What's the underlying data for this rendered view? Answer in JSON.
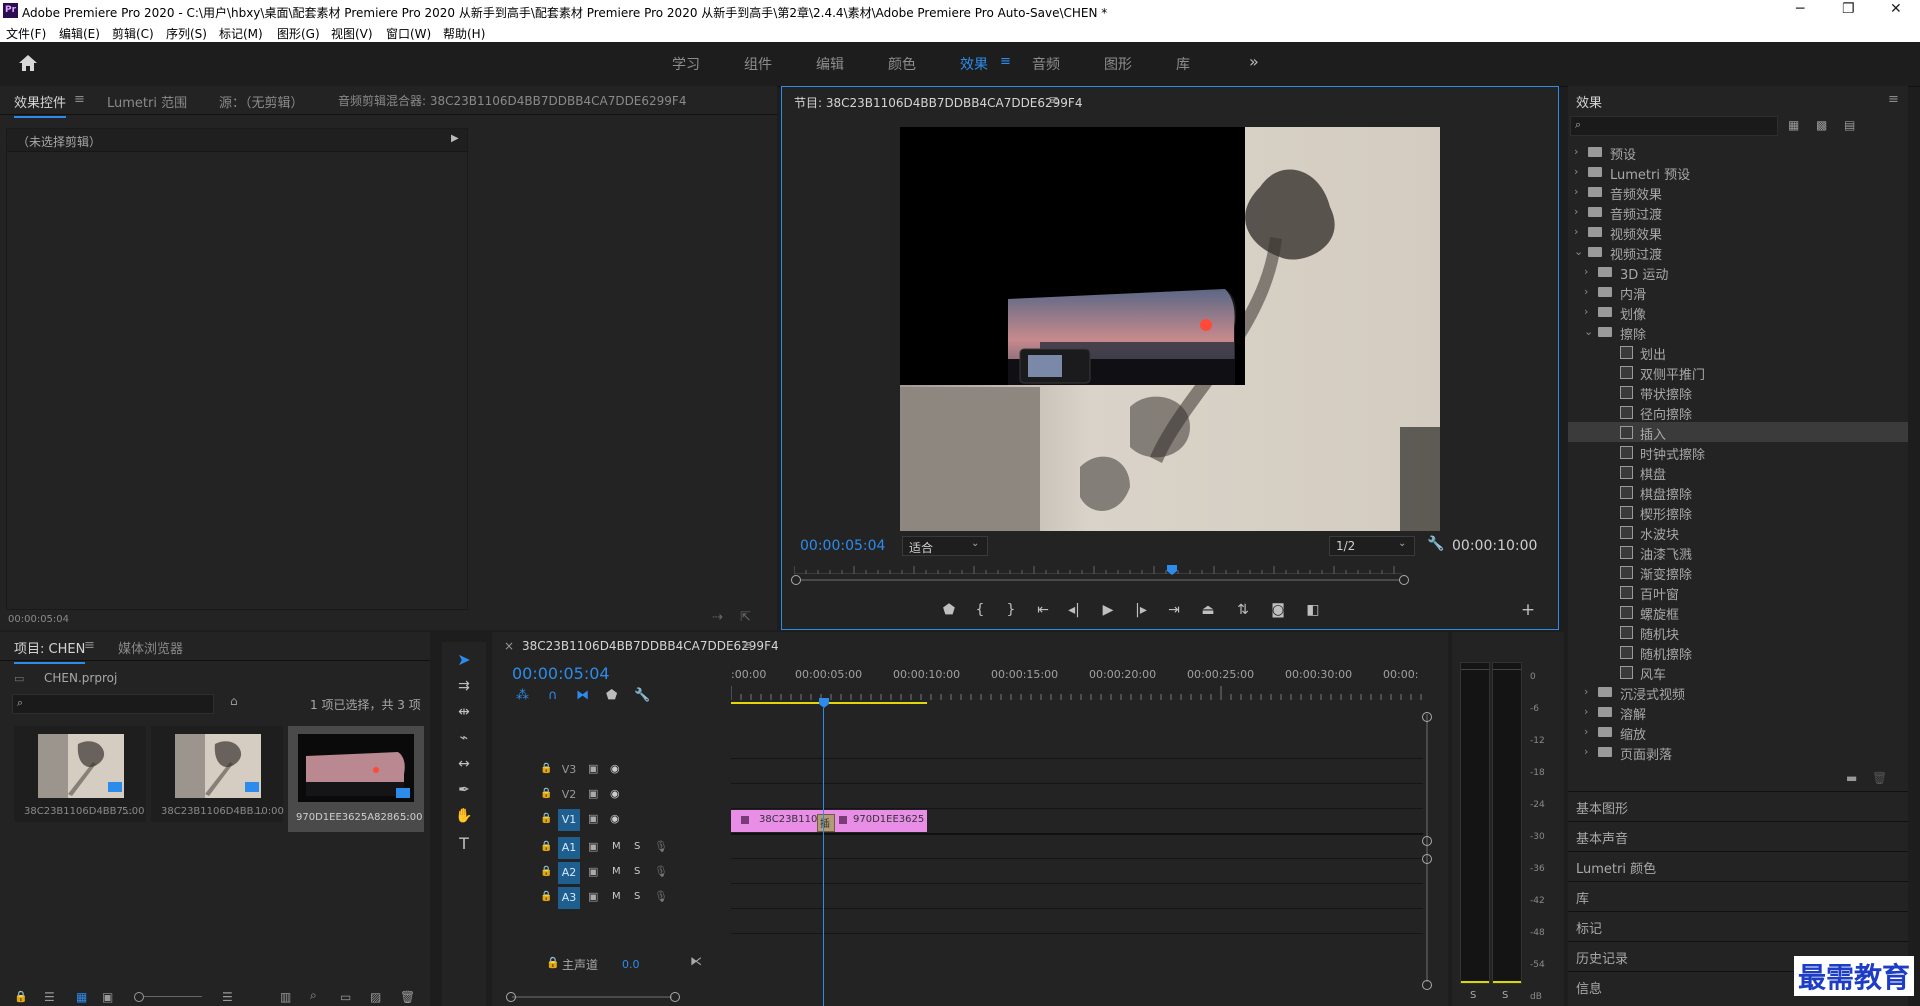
{
  "window": {
    "app_icon": "Pr",
    "title": "Adobe Premiere Pro 2020 - C:\\用户\\hbxy\\桌面\\配套素材 Premiere Pro 2020 从新手到高手\\配套素材 Premiere Pro 2020 从新手到高手\\第2章\\2.4.4\\素材\\Adobe Premiere Pro Auto-Save\\CHEN *",
    "minimize": "─",
    "maximize": "❐",
    "close": "✕"
  },
  "menu": [
    "文件(F)",
    "编辑(E)",
    "剪辑(C)",
    "序列(S)",
    "标记(M)",
    "图形(G)",
    "视图(V)",
    "窗口(W)",
    "帮助(H)"
  ],
  "workspaces": {
    "tabs": [
      "学习",
      "组件",
      "编辑",
      "颜色",
      "效果",
      "音频",
      "图形",
      "库"
    ],
    "active": "效果",
    "more": "»"
  },
  "effect_controls": {
    "tabs": [
      "效果控件",
      "Lumetri 范围",
      "源：（无剪辑）",
      "音频剪辑混合器: 38C23B1106D4BB7DDBB4CA7DDE6299F4"
    ],
    "no_clip": "（未选择剪辑）",
    "timecode": "00:00:05:04"
  },
  "program": {
    "title": "节目: 38C23B1106D4BB7DDBB4CA7DDE6299F4",
    "current_time": "00:00:05:04",
    "fit": "适合",
    "resolution": "1/2",
    "duration": "00:00:10:00",
    "playhead_fraction": 0.5
  },
  "effects": {
    "title": "效果",
    "search_placeholder": "",
    "tree": [
      {
        "label": "预设",
        "kind": "folder",
        "level": 0,
        "open": false
      },
      {
        "label": "Lumetri 预设",
        "kind": "folder",
        "level": 0,
        "open": false
      },
      {
        "label": "音频效果",
        "kind": "folder",
        "level": 0,
        "open": false
      },
      {
        "label": "音频过渡",
        "kind": "folder",
        "level": 0,
        "open": false
      },
      {
        "label": "视频效果",
        "kind": "folder",
        "level": 0,
        "open": false
      },
      {
        "label": "视频过渡",
        "kind": "folder",
        "level": 0,
        "open": true
      },
      {
        "label": "3D 运动",
        "kind": "folder",
        "level": 1,
        "open": false
      },
      {
        "label": "内滑",
        "kind": "folder",
        "level": 1,
        "open": false
      },
      {
        "label": "划像",
        "kind": "folder",
        "level": 1,
        "open": false
      },
      {
        "label": "擦除",
        "kind": "folder",
        "level": 1,
        "open": true
      },
      {
        "label": "划出",
        "kind": "fx",
        "level": 2
      },
      {
        "label": "双侧平推门",
        "kind": "fx",
        "level": 2
      },
      {
        "label": "带状擦除",
        "kind": "fx",
        "level": 2
      },
      {
        "label": "径向擦除",
        "kind": "fx",
        "level": 2
      },
      {
        "label": "插入",
        "kind": "fx",
        "level": 2,
        "selected": true
      },
      {
        "label": "时钟式擦除",
        "kind": "fx",
        "level": 2
      },
      {
        "label": "棋盘",
        "kind": "fx",
        "level": 2
      },
      {
        "label": "棋盘擦除",
        "kind": "fx",
        "level": 2
      },
      {
        "label": "楔形擦除",
        "kind": "fx",
        "level": 2
      },
      {
        "label": "水波块",
        "kind": "fx",
        "level": 2
      },
      {
        "label": "油漆飞溅",
        "kind": "fx",
        "level": 2
      },
      {
        "label": "渐变擦除",
        "kind": "fx",
        "level": 2
      },
      {
        "label": "百叶窗",
        "kind": "fx",
        "level": 2
      },
      {
        "label": "螺旋框",
        "kind": "fx",
        "level": 2
      },
      {
        "label": "随机块",
        "kind": "fx",
        "level": 2
      },
      {
        "label": "随机擦除",
        "kind": "fx",
        "level": 2
      },
      {
        "label": "风车",
        "kind": "fx",
        "level": 2
      },
      {
        "label": "沉浸式视频",
        "kind": "folder",
        "level": 1,
        "open": false
      },
      {
        "label": "溶解",
        "kind": "folder",
        "level": 1,
        "open": false
      },
      {
        "label": "缩放",
        "kind": "folder",
        "level": 1,
        "open": false
      },
      {
        "label": "页面剥落",
        "kind": "folder",
        "level": 1,
        "open": false
      }
    ],
    "sections": [
      "基本图形",
      "基本声音",
      "Lumetri 颜色",
      "库",
      "标记",
      "历史记录",
      "信息"
    ]
  },
  "project": {
    "tabs": [
      "项目: CHEN",
      "媒体浏览器"
    ],
    "file": "CHEN.prproj",
    "selection": "1 项已选择，共 3 项",
    "items": [
      {
        "name": "38C23B1106D4BB7...",
        "duration": "5:00"
      },
      {
        "name": "38C23B1106D4BB...",
        "duration": "10:00"
      },
      {
        "name": "970D1EE3625A8286...",
        "duration": "5:00"
      }
    ]
  },
  "timeline": {
    "sequence": "38C23B1106D4BB7DDBB4CA7DDE6299F4",
    "close": "×",
    "timecode": "00:00:05:04",
    "ruler": [
      ":00:00",
      "00:00:05:00",
      "00:00:10:00",
      "00:00:15:00",
      "00:00:20:00",
      "00:00:25:00",
      "00:00:30:00",
      "00:00:"
    ],
    "video_tracks": [
      "V3",
      "V2",
      "V1"
    ],
    "audio_tracks": [
      "A1",
      "A2",
      "A3"
    ],
    "master": {
      "label": "主声道",
      "value": "0.0"
    },
    "clips": [
      {
        "name": "38C23B1106",
        "track": "V1"
      },
      {
        "name": "970D1EE3625",
        "track": "V1"
      }
    ],
    "transition_label": "插"
  },
  "meter": {
    "scale": [
      "0",
      "-6",
      "-12",
      "-18",
      "-24",
      "-30",
      "-36",
      "-42",
      "-48",
      "-54",
      "dB"
    ],
    "solo": [
      "S",
      "S"
    ]
  },
  "watermark": "最需教育",
  "colors": {
    "accent": "#2d8ceb",
    "clip": "#e98ee6",
    "panel": "#232323"
  }
}
